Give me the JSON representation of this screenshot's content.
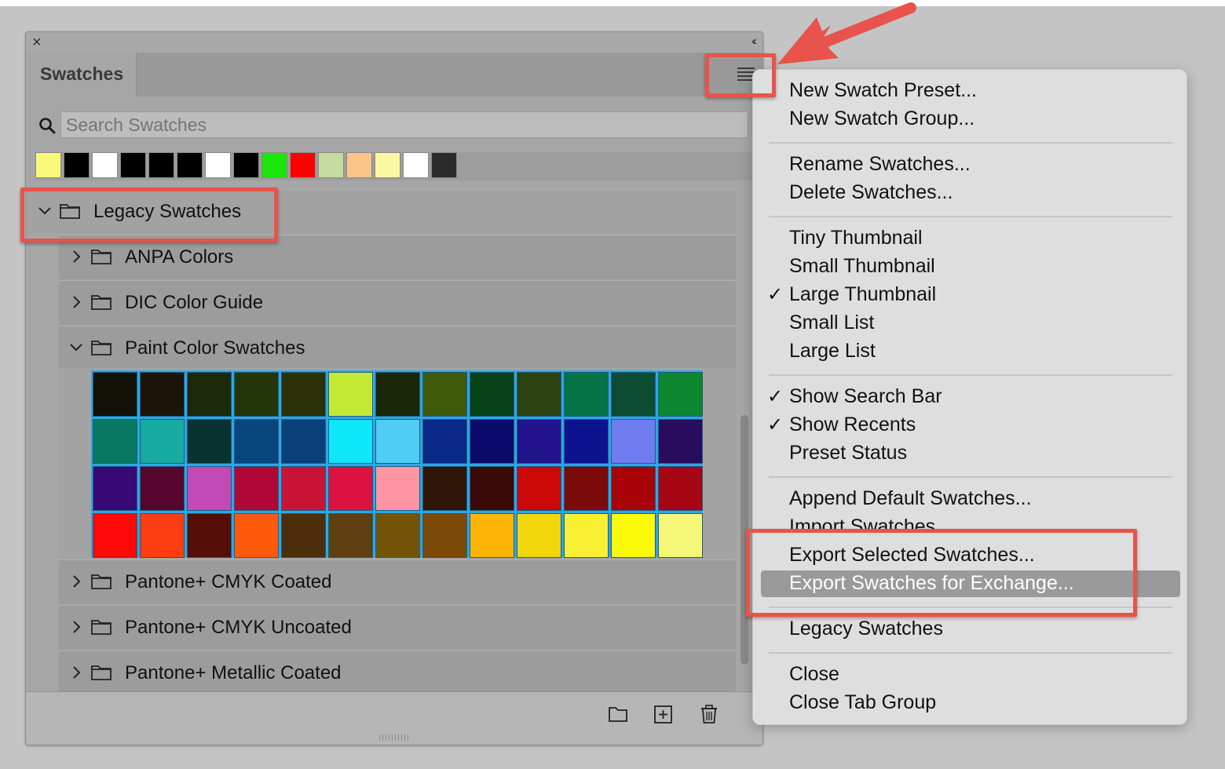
{
  "panel": {
    "tab_label": "Swatches",
    "search_placeholder": "Search Swatches",
    "recents": [
      "#f8f87a",
      "#000000",
      "#ffffff",
      "#000000",
      "#000000",
      "#000000",
      "#ffffff",
      "#000000",
      "#19e60a",
      "#ff0000",
      "#c6db9e",
      "#fbc589",
      "#fbf8a2",
      "#ffffff",
      "#2a2a2a"
    ],
    "groups": [
      {
        "label": "Legacy Swatches",
        "expanded": true
      },
      {
        "label": "ANPA Colors",
        "expanded": false
      },
      {
        "label": "DIC Color Guide",
        "expanded": false
      },
      {
        "label": "Paint Color Swatches",
        "expanded": true
      },
      {
        "label": "Pantone+ CMYK Coated",
        "expanded": false
      },
      {
        "label": "Pantone+ CMYK Uncoated",
        "expanded": false
      },
      {
        "label": "Pantone+ Metallic Coated",
        "expanded": false
      }
    ],
    "paint_swatches": [
      "#121007",
      "#1b1408",
      "#1c2909",
      "#233509",
      "#2c310a",
      "#c4e833",
      "#1c2708",
      "#3f5a08",
      "#074218",
      "#2c4311",
      "#077447",
      "#0b4c33",
      "#0c8730",
      "#087860",
      "#17aaa0",
      "#093330",
      "#09467d",
      "#0a4078",
      "#0ee6f9",
      "#4fcdf4",
      "#0a2888",
      "#0b0b6b",
      "#23138c",
      "#0d128e",
      "#6f7cf0",
      "#290c5e",
      "#3a0978",
      "#56052e",
      "#c24ab4",
      "#b00638",
      "#c81236",
      "#dc1241",
      "#ff95a2",
      "#2f1508",
      "#3b0a08",
      "#cb0808",
      "#7c0a0a",
      "#a80407",
      "#a40613",
      "#ff0808",
      "#ff3d13",
      "#540d07",
      "#ff5a0b",
      "#4c2e0b",
      "#5e3f10",
      "#745508",
      "#7c4a07",
      "#ffb507",
      "#f0d60a",
      "#f9ef33",
      "#fbfb09",
      "#f6f778"
    ]
  },
  "menu": {
    "items": [
      {
        "label": "New Swatch Preset...",
        "checked": false
      },
      {
        "label": "New Swatch Group...",
        "checked": false
      },
      {
        "label": "Rename Swatches...",
        "checked": false
      },
      {
        "label": "Delete Swatches...",
        "checked": false
      },
      {
        "label": "Tiny Thumbnail",
        "checked": false
      },
      {
        "label": "Small Thumbnail",
        "checked": false
      },
      {
        "label": "Large Thumbnail",
        "checked": true
      },
      {
        "label": "Small List",
        "checked": false
      },
      {
        "label": "Large List",
        "checked": false
      },
      {
        "label": "Show Search Bar",
        "checked": true
      },
      {
        "label": "Show Recents",
        "checked": true
      },
      {
        "label": "Preset Status",
        "checked": false
      },
      {
        "label": "Append Default Swatches...",
        "checked": false
      },
      {
        "label": "Import Swatches...",
        "checked": false
      },
      {
        "label": "Export Selected Swatches...",
        "checked": false
      },
      {
        "label": "Export Swatches for Exchange...",
        "checked": false
      },
      {
        "label": "Legacy Swatches",
        "checked": false
      },
      {
        "label": "Close",
        "checked": false
      },
      {
        "label": "Close Tab Group",
        "checked": false
      }
    ],
    "checkmark": "✓"
  },
  "colors": {
    "highlight_red": "#e8534b",
    "selection_blue": "#2ea6e6"
  }
}
